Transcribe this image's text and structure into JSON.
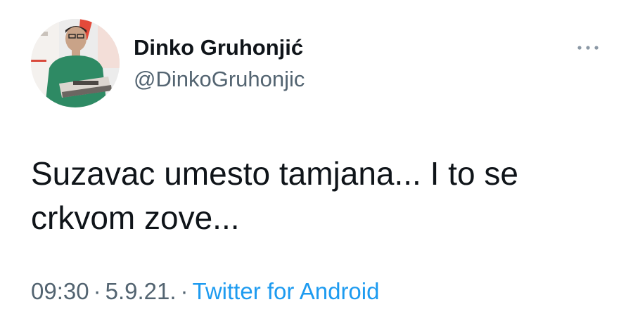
{
  "author": {
    "display_name": "Dinko Gruhonjić",
    "handle": "@DinkoGruhonjic"
  },
  "tweet": {
    "text_line1": "Suzavac umesto tamjana... I to se",
    "text_line2": "crkvom zove..."
  },
  "meta": {
    "time": "09:30",
    "separator": "·",
    "date": "5.9.21.",
    "source": "Twitter for Android"
  },
  "colors": {
    "text_primary": "#0f1419",
    "text_secondary": "#536471",
    "link": "#1d9bf0"
  },
  "icons": {
    "more": "more-horizontal-icon",
    "avatar": "profile-photo"
  }
}
